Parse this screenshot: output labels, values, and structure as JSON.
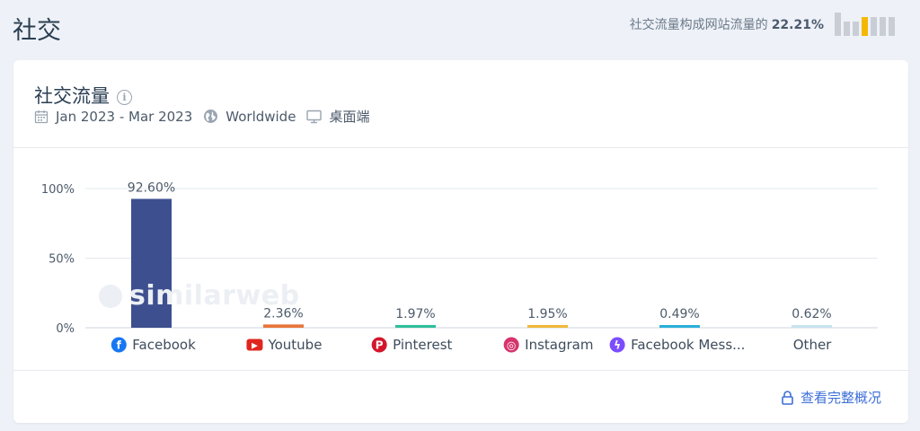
{
  "header": {
    "title": "社交",
    "share_text": "社交流量构成网站流量的",
    "share_value": "22.21%",
    "share_bar_levels": [
      1,
      0.6,
      0.6,
      0.8,
      0.8,
      0.8,
      0.8
    ],
    "share_bar_highlight_index": 3
  },
  "card": {
    "title": "社交流量",
    "date_range": "Jan 2023 - Mar 2023",
    "region": "Worldwide",
    "device": "桌面端",
    "footer_link": "查看完整概况",
    "watermark": "similarweb"
  },
  "chart_data": {
    "type": "bar",
    "categories": [
      "Facebook",
      "Youtube",
      "Pinterest",
      "Instagram",
      "Facebook Mess...",
      "Other"
    ],
    "values": [
      92.6,
      2.36,
      1.97,
      1.95,
      0.49,
      0.62
    ],
    "value_labels": [
      "92.60%",
      "2.36%",
      "1.97%",
      "1.95%",
      "0.49%",
      "0.62%"
    ],
    "colors": [
      "#3d4f8f",
      "#e8753a",
      "#2fbf9b",
      "#f0b93b",
      "#2ab0d8",
      "#c7e3ef"
    ],
    "icons": [
      "facebook-icon",
      "youtube-icon",
      "pinterest-icon",
      "instagram-icon",
      "messenger-icon",
      ""
    ],
    "y_ticks": [
      "100%",
      "50%",
      "0%"
    ],
    "ylim": [
      0,
      100
    ],
    "grid": true
  }
}
